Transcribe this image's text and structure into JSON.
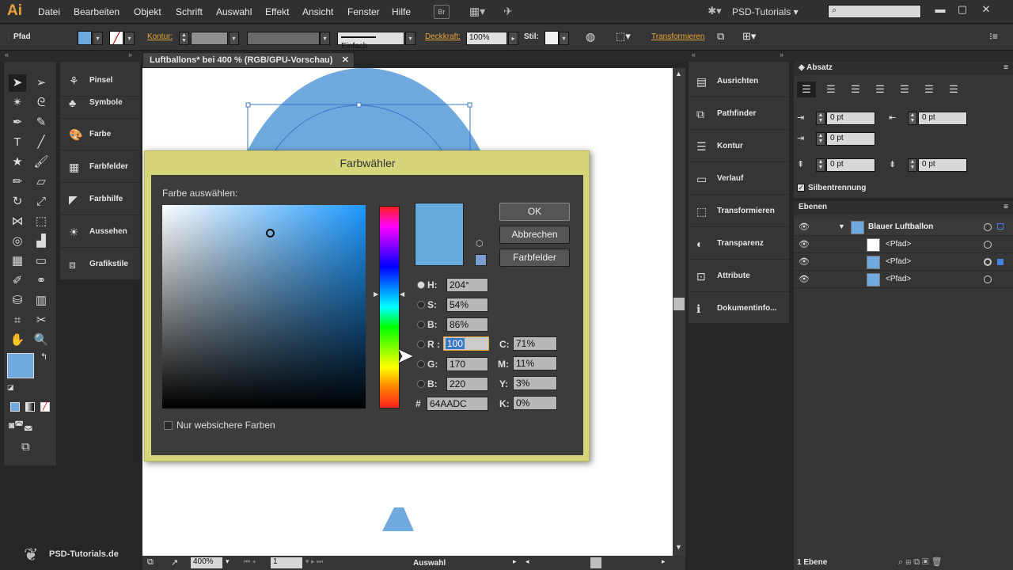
{
  "app": {
    "logo": "Ai",
    "workspace": "PSD-Tutorials",
    "menu": [
      "Datei",
      "Bearbeiten",
      "Objekt",
      "Schrift",
      "Auswahl",
      "Effekt",
      "Ansicht",
      "Fenster",
      "Hilfe"
    ],
    "br_label": "Br"
  },
  "control": {
    "type": "Pfad",
    "kontur_label": "Kontur:",
    "stroke_style": "Einfach",
    "opacity_label": "Deckkraft:",
    "opacity": "100%",
    "stil_label": "Stil:",
    "transform_link": "Transformieren"
  },
  "document": {
    "tab_title": "Luftballons* bei 400 % (RGB/GPU-Vorschau)"
  },
  "left_dock": [
    "Pinsel",
    "Symbole",
    "Farbe",
    "Farbfelder",
    "Farbhilfe",
    "Aussehen",
    "Grafikstile"
  ],
  "right_dock": [
    "Ausrichten",
    "Pathfinder",
    "Kontur",
    "Verlauf",
    "Transformieren",
    "Transparenz",
    "Attribute",
    "Dokumentinfo..."
  ],
  "absatz": {
    "title": "Absatz",
    "left_indent": "0 pt",
    "right_indent": "0 pt",
    "first_indent": "0 pt",
    "space_before": "0 pt",
    "space_after": "0 pt",
    "hyphenation": "Silbentrennung"
  },
  "ebenen": {
    "title": "Ebenen",
    "layer": "Blauer Luftballon",
    "items": [
      "<Pfad>",
      "<Pfad>",
      "<Pfad>"
    ],
    "count": "1 Ebene"
  },
  "dialog": {
    "title": "Farbwähler",
    "choose_label": "Farbe auswählen:",
    "ok": "OK",
    "cancel": "Abbrechen",
    "swatches": "Farbfelder",
    "H": "204°",
    "S": "54%",
    "Bv": "86%",
    "R": "100",
    "G": "170",
    "Bb": "220",
    "C": "71%",
    "M": "11%",
    "Y": "3%",
    "K": "0%",
    "hex": "64AADC",
    "web_safe": "Nur websichere Farben",
    "labels": {
      "H": "H:",
      "S": "S:",
      "B": "B:",
      "R": "R :",
      "G": "G:",
      "B2": "B:",
      "C": "C:",
      "M": "M:",
      "Y": "Y:",
      "K": "K:",
      "hash": "#"
    }
  },
  "statusbar": {
    "zoom": "400%",
    "page": "1",
    "tool": "Auswahl"
  },
  "watermark": "PSD-Tutorials.de",
  "colors": {
    "balloon": "#6fa9dd",
    "selected": "#64aadc",
    "dialog_frame": "#d6d57a",
    "accent_orange": "#e8a23a"
  }
}
